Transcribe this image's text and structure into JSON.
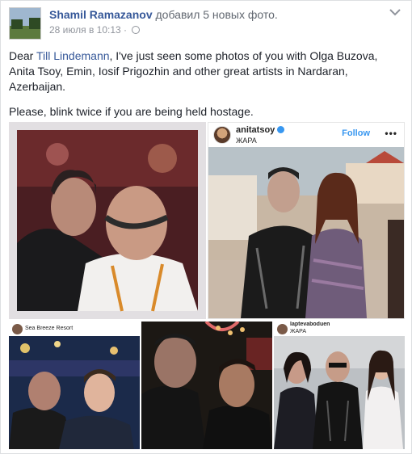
{
  "post": {
    "author_name": "Shamil Ramazanov",
    "action_text": "добавил 5 новых фото.",
    "timestamp": "28 июля в 10:13 ·",
    "privacy_icon": "globe-icon",
    "menu_icon": "chevron-down-icon",
    "text": {
      "line1_prefix": "Dear ",
      "mention": "Till Lindemann",
      "line1_suffix": ", I've just seen some photos of you with Olga Buzova, Anita Tsoy, Emin, Iosif Prigozhin and other great artists in Nardaran, Azerbaijan.",
      "line2": "Please, blink twice if you are being held hostage."
    }
  },
  "photos": {
    "photo2": {
      "username": "anitatsoy",
      "location": "ЖАРА",
      "follow_label": "Follow",
      "more_label": "•••"
    },
    "photo3": {
      "location": "Sea Breeze Resort"
    },
    "photo5": {
      "username": "laptevaboduen",
      "location": "ЖАРА"
    }
  },
  "colors": {
    "link": "#365899",
    "secondary_text": "#90949c",
    "ig_blue": "#3897f0"
  }
}
